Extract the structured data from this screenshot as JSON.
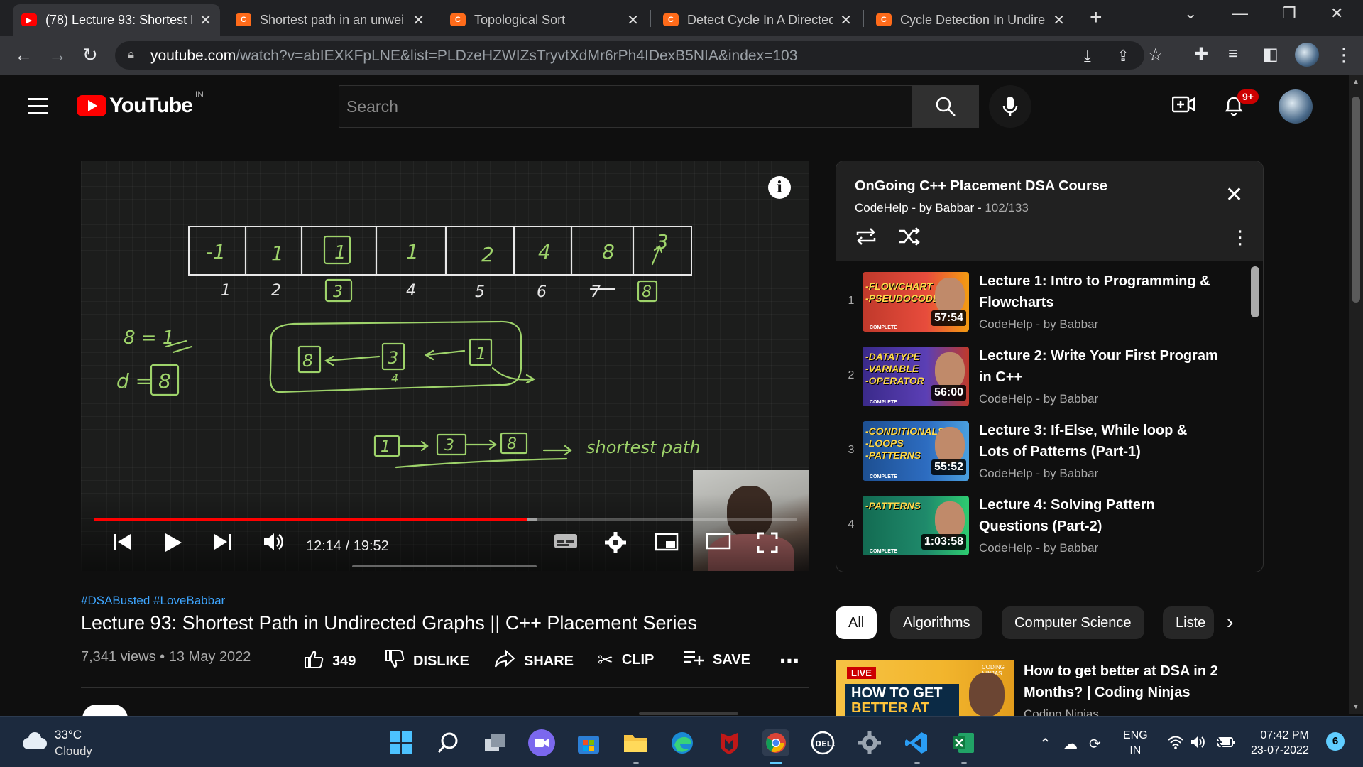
{
  "browser": {
    "tabs": [
      {
        "title": "(78) Lecture 93: Shortest P",
        "favicon": "youtube-icon",
        "active": true
      },
      {
        "title": "Shortest path in an unwei",
        "favicon": "codestudio-icon",
        "active": false
      },
      {
        "title": "Topological Sort",
        "favicon": "codestudio-icon",
        "active": false
      },
      {
        "title": "Detect Cycle In A Directed",
        "favicon": "codestudio-icon",
        "active": false
      },
      {
        "title": "Cycle Detection In Undire",
        "favicon": "codestudio-icon",
        "active": false
      }
    ],
    "url_host": "youtube.com",
    "url_path": "/watch?v=abIEXKFpLNE&list=PLDzeHZWIZsTryvtXdMr6rPh4IDexB5NIA&index=103"
  },
  "youtube": {
    "logo_text": "YouTube",
    "region": "IN",
    "search_placeholder": "Search",
    "notification_count": "9+"
  },
  "video": {
    "current_time": "12:14",
    "duration": "19:52",
    "time_display": "12:14 / 19:52",
    "played_fraction": 0.616,
    "loaded_fraction": 0.63,
    "hashtags": "#DSABusted #LoveBabbar",
    "title": "Lecture 93: Shortest Path in Undirected Graphs || C++ Placement Series",
    "meta": "7,341 views • 13 May 2022",
    "likes": "349",
    "dislike_label": "DISLIKE",
    "share_label": "SHARE",
    "clip_label": "CLIP",
    "save_label": "SAVE"
  },
  "board": {
    "cells": [
      "-1",
      "1",
      "1",
      "1",
      "2",
      "4",
      "8",
      "3"
    ],
    "indices": [
      "1",
      "2",
      "3",
      "4",
      "5",
      "6",
      "7",
      "8"
    ],
    "note1": "8 = 1",
    "note2": "d = 8",
    "stack": [
      "8",
      "3",
      "1"
    ],
    "stack_sub": "4",
    "path": [
      "1",
      "3",
      "8"
    ],
    "path_label": "shortest path"
  },
  "playlist": {
    "title": "OnGoing C++ Placement DSA Course",
    "channel": "CodeHelp - by Babbar",
    "count": "102/133",
    "items": [
      {
        "index": "1",
        "title": "Lecture 1: Intro to Programming & Flowcharts",
        "channel": "CodeHelp - by Babbar",
        "duration": "57:54",
        "thumb_text": "-FLOWCHART\n-PSEUDOCODE",
        "thumb_color": "#c0392b"
      },
      {
        "index": "2",
        "title": "Lecture 2: Write Your First Program in C++",
        "channel": "CodeHelp - by Babbar",
        "duration": "56:00",
        "thumb_text": "-DATATYPE\n-VARIABLE\n-OPERATOR",
        "thumb_color": "#5b3fb5"
      },
      {
        "index": "3",
        "title": "Lecture 3: If-Else, While loop & Lots of Patterns (Part-1)",
        "channel": "CodeHelp - by Babbar",
        "duration": "55:52",
        "thumb_text": "-CONDITIONALS\n-LOOPS\n-PATTERNS",
        "thumb_color": "#2d6cc0"
      },
      {
        "index": "4",
        "title": "Lecture 4: Solving Pattern Questions (Part-2)",
        "channel": "CodeHelp - by Babbar",
        "duration": "1:03:58",
        "thumb_text": "-PATTERNS",
        "thumb_color": "#1f8a6b"
      }
    ]
  },
  "chips": [
    "All",
    "Algorithms",
    "Computer Science",
    "Liste"
  ],
  "recommended": {
    "live_label": "LIVE",
    "thumb_line1": "HOW TO GET",
    "thumb_line2": "BETTER AT DSA",
    "brand": "CODING NINJAS",
    "title": "How to get better at DSA in 2 Months? | Coding Ninjas",
    "channel": "Coding Ninjas"
  },
  "taskbar": {
    "temperature": "33°C",
    "condition": "Cloudy",
    "lang1": "ENG",
    "lang2": "IN",
    "time": "07:42 PM",
    "date": "23-07-2022",
    "notification_count": "6"
  },
  "colors": {
    "yt_red": "#ff0000",
    "link_blue": "#3ea6ff",
    "chalk_green": "#9ed36a"
  }
}
